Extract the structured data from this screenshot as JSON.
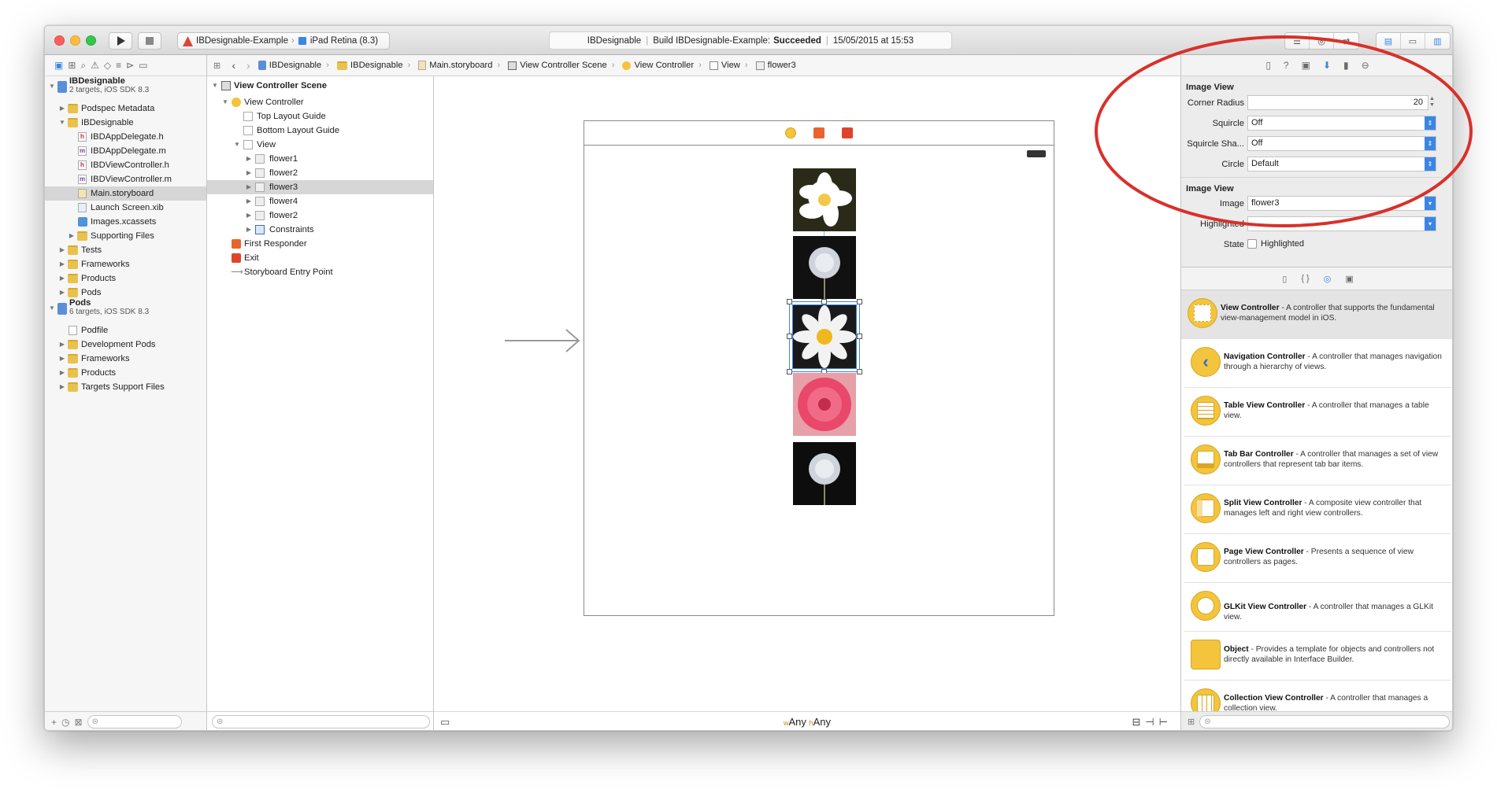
{
  "toolbar": {
    "scheme": "IBDesignable-Example",
    "device": "iPad Retina (8.3)",
    "activity_project": "IBDesignable",
    "activity_build_prefix": "Build IBDesignable-Example:",
    "activity_build_status": "Succeeded",
    "activity_date": "15/05/2015 at 15:53"
  },
  "navigator": {
    "project": {
      "name": "IBDesignable",
      "subtitle": "2 targets, iOS SDK 8.3"
    },
    "items": [
      {
        "label": "Podspec Metadata"
      },
      {
        "label": "IBDesignable"
      },
      {
        "label": "IBDAppDelegate.h"
      },
      {
        "label": "IBDAppDelegate.m"
      },
      {
        "label": "IBDViewController.h"
      },
      {
        "label": "IBDViewController.m"
      },
      {
        "label": "Main.storyboard"
      },
      {
        "label": "Launch Screen.xib"
      },
      {
        "label": "Images.xcassets"
      },
      {
        "label": "Supporting Files"
      },
      {
        "label": "Tests"
      },
      {
        "label": "Frameworks"
      },
      {
        "label": "Products"
      },
      {
        "label": "Pods"
      }
    ],
    "pods_project": {
      "name": "Pods",
      "subtitle": "6 targets, iOS SDK 8.3"
    },
    "pods_items": [
      {
        "label": "Podfile"
      },
      {
        "label": "Development Pods"
      },
      {
        "label": "Frameworks"
      },
      {
        "label": "Products"
      },
      {
        "label": "Targets Support Files"
      }
    ]
  },
  "jumpbar": [
    "IBDesignable",
    "IBDesignable",
    "Main.storyboard",
    "View Controller Scene",
    "View Controller",
    "View",
    "flower3"
  ],
  "outline": {
    "scene": "View Controller Scene",
    "controller": "View Controller",
    "top_guide": "Top Layout Guide",
    "bottom_guide": "Bottom Layout Guide",
    "view": "View",
    "flowers": [
      "flower1",
      "flower2",
      "flower3",
      "flower4",
      "flower2"
    ],
    "constraints": "Constraints",
    "first_responder": "First Responder",
    "exit": "Exit",
    "entry_point": "Storyboard Entry Point"
  },
  "canvas": {
    "size_w_prefix": "w",
    "size_w": "Any",
    "size_h_prefix": "h",
    "size_h": "Any"
  },
  "inspector": {
    "section1_title": "Image View",
    "corner_radius_label": "Corner Radius",
    "corner_radius_value": "20",
    "squircle_label": "Squircle",
    "squircle_value": "Off",
    "squircle_shadow_label": "Squircle Sha...",
    "squircle_shadow_value": "Off",
    "circle_label": "Circle",
    "circle_value": "Default",
    "section2_title": "Image View",
    "image_label": "Image",
    "image_value": "flower3",
    "highlighted_label": "Highlighted",
    "highlighted_value": "",
    "state_label": "State",
    "state_checkbox_label": "Highlighted"
  },
  "library": [
    {
      "title": "View Controller",
      "desc": " - A controller that supports the fundamental view-management model in iOS."
    },
    {
      "title": "Navigation Controller",
      "desc": " - A controller that manages navigation through a hierarchy of views."
    },
    {
      "title": "Table View Controller",
      "desc": " - A controller that manages a table view."
    },
    {
      "title": "Tab Bar Controller",
      "desc": " - A controller that manages a set of view controllers that represent tab bar items."
    },
    {
      "title": "Split View Controller",
      "desc": " - A composite view controller that manages left and right view controllers."
    },
    {
      "title": "Page View Controller",
      "desc": " - Presents a sequence of view controllers as pages."
    },
    {
      "title": "GLKit View Controller",
      "desc": " - A controller that manages a GLKit view."
    },
    {
      "title": "Object",
      "desc": " - Provides a template for objects and controllers not directly available in Interface Builder."
    },
    {
      "title": "Collection View Controller",
      "desc": " - A controller that manages a collection view."
    }
  ],
  "colors": {
    "accent": "#3b86e4",
    "annotation": "#d9302a",
    "library_icon": "#f3c43c"
  }
}
